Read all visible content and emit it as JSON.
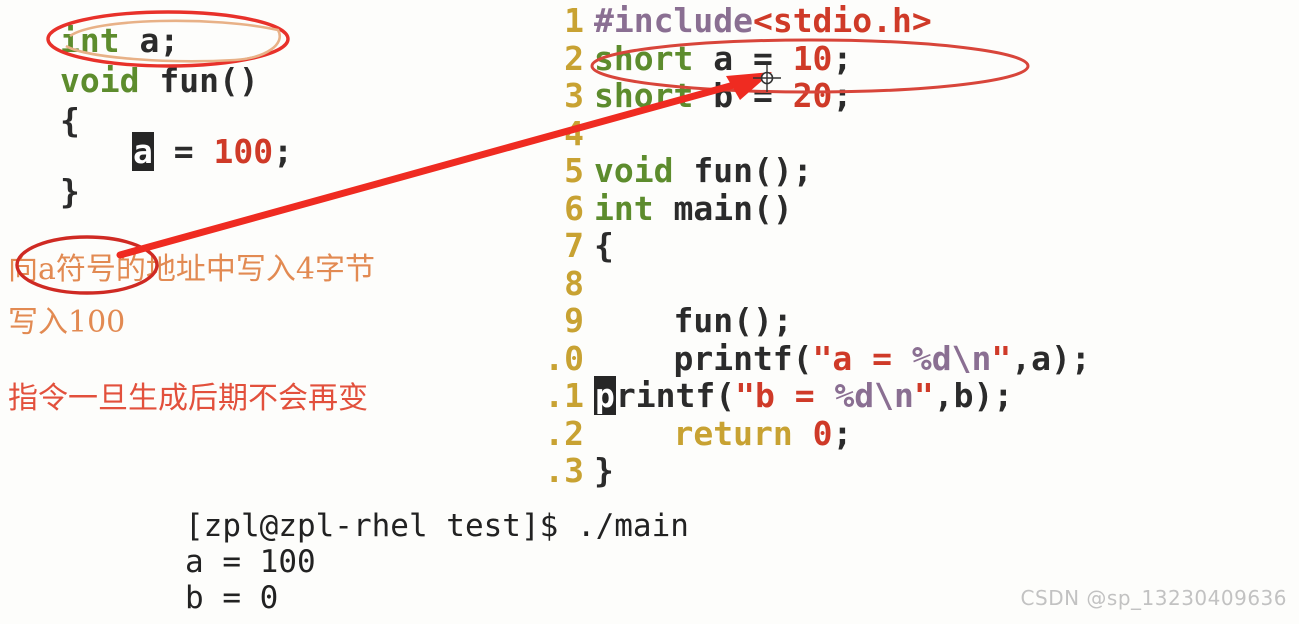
{
  "left_snippet": {
    "name": "left-code-snippet",
    "lines": [
      {
        "indent": 0,
        "tokens": [
          {
            "t": "int",
            "c": "kw-green"
          },
          {
            "t": " a;",
            "c": "plain"
          }
        ]
      },
      {
        "indent": 0,
        "tokens": [
          {
            "t": "void",
            "c": "kw-green"
          },
          {
            "t": " fun()",
            "c": "plain"
          }
        ]
      },
      {
        "indent": 0,
        "tokens": [
          {
            "t": "{",
            "c": "plain"
          }
        ]
      },
      {
        "indent": 1,
        "tokens": [
          {
            "t": "a",
            "c": "cursor-block"
          },
          {
            "t": " = ",
            "c": "plain"
          },
          {
            "t": "100",
            "c": "lit-red"
          },
          {
            "t": ";",
            "c": "plain"
          }
        ]
      },
      {
        "indent": 0,
        "tokens": [
          {
            "t": "}",
            "c": "plain"
          }
        ]
      }
    ]
  },
  "right_editor": {
    "name": "vim-source-buffer",
    "line_numbers": [
      "1",
      "2",
      "3",
      "4",
      "5",
      "6",
      "7",
      "8",
      "9",
      ".0",
      ".1",
      ".2",
      ".3"
    ],
    "lines": [
      {
        "tokens": [
          {
            "t": "#include",
            "c": "pp-purple"
          },
          {
            "t": "<stdio.h>",
            "c": "lit-red"
          }
        ]
      },
      {
        "tokens": [
          {
            "t": "short",
            "c": "kw-green"
          },
          {
            "t": " a = ",
            "c": "plain"
          },
          {
            "t": "10",
            "c": "lit-red"
          },
          {
            "t": ";",
            "c": "plain"
          }
        ]
      },
      {
        "tokens": [
          {
            "t": "short",
            "c": "kw-green"
          },
          {
            "t": " b = ",
            "c": "plain"
          },
          {
            "t": "20",
            "c": "lit-red"
          },
          {
            "t": ";",
            "c": "plain"
          }
        ]
      },
      {
        "tokens": [
          {
            "t": "",
            "c": "plain"
          }
        ]
      },
      {
        "tokens": [
          {
            "t": "void",
            "c": "kw-green"
          },
          {
            "t": " fun();",
            "c": "plain"
          }
        ]
      },
      {
        "tokens": [
          {
            "t": "int",
            "c": "kw-green"
          },
          {
            "t": " main()",
            "c": "plain"
          }
        ]
      },
      {
        "tokens": [
          {
            "t": "{",
            "c": "plain"
          }
        ]
      },
      {
        "tokens": [
          {
            "t": "",
            "c": "plain"
          }
        ]
      },
      {
        "tokens": [
          {
            "t": "    fun();",
            "c": "plain"
          }
        ]
      },
      {
        "tokens": [
          {
            "t": "    printf(",
            "c": "plain"
          },
          {
            "t": "\"a = ",
            "c": "lit-red"
          },
          {
            "t": "%d\\n",
            "c": "pp-purple"
          },
          {
            "t": "\"",
            "c": "lit-red"
          },
          {
            "t": ",a);",
            "c": "plain"
          }
        ]
      },
      {
        "tokens": [
          {
            "t": "p",
            "c": "cursor-block"
          },
          {
            "t": "rintf(",
            "c": "plain"
          },
          {
            "t": "\"b = ",
            "c": "lit-red"
          },
          {
            "t": "%d\\n",
            "c": "pp-purple"
          },
          {
            "t": "\"",
            "c": "lit-red"
          },
          {
            "t": ",b);",
            "c": "plain"
          }
        ]
      },
      {
        "tokens": [
          {
            "t": "    ",
            "c": "plain"
          },
          {
            "t": "return",
            "c": "kw-gold"
          },
          {
            "t": " ",
            "c": "plain"
          },
          {
            "t": "0",
            "c": "lit-red"
          },
          {
            "t": ";",
            "c": "plain"
          }
        ]
      },
      {
        "tokens": [
          {
            "t": "}",
            "c": "plain"
          }
        ]
      }
    ]
  },
  "terminal": {
    "name": "shell-output",
    "prompt_line": "[zpl@zpl-rhel test]$ ./main",
    "output_lines": [
      "a = 100",
      "b = 0"
    ]
  },
  "annotations": {
    "note_1": "向a符号的地址中写入4字节",
    "note_2": "写入100",
    "note_3": "指令一旦生成后期不会再变"
  },
  "watermark": {
    "text": "CSDN @sp_13230409636"
  },
  "colors": {
    "keyword_green": "#5d8c2d",
    "keyword_gold": "#c8a232",
    "literal_red": "#cf3a28",
    "preprocessor_purple": "#8a6f92",
    "line_number_gold": "#c8a232",
    "annotation_orange": "#e28a52",
    "annotation_red": "#e2503c",
    "markup_red": "#e8312a",
    "markup_tan": "#e0a878",
    "cursor_block": "#262626",
    "background": "#fdfdfb",
    "watermark_gray": "#c2c2c2"
  },
  "markup": {
    "ellipse_left_label": "ellipse-around-int-a",
    "ellipse_right_label": "ellipse-around-short-a-10",
    "ellipse_note_label": "ellipse-around-note-1",
    "arrow_label": "arrow-from-note-to-variable-a"
  }
}
